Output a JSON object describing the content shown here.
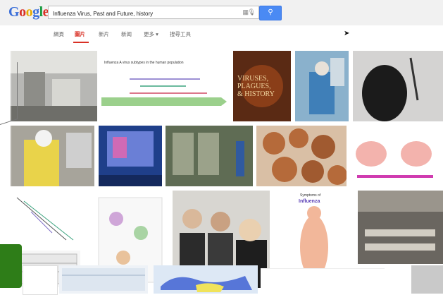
{
  "search": {
    "query": "Influenza Virus, Past and Future, history"
  },
  "logo": {
    "text": "Google"
  },
  "nav": {
    "items": [
      {
        "label": "網頁",
        "active": false
      },
      {
        "label": "圖片",
        "active": true
      },
      {
        "label": "新片",
        "active": false
      },
      {
        "label": "新闻",
        "active": false
      },
      {
        "label": "更多",
        "active": false
      },
      {
        "label": "搜尋工具",
        "active": false
      }
    ]
  },
  "images": {
    "book_title": [
      "VIRUSES,",
      "PLAGUES,",
      "& HISTORY"
    ],
    "chart_title": "Influenza A virus subtypes in the human population",
    "influenza_title": "Symptoms of",
    "influenza_word": "Influenza"
  },
  "colors": {
    "accent": "#d93025",
    "search_button": "#4a8af4",
    "green_panel": "#2e7d18"
  }
}
